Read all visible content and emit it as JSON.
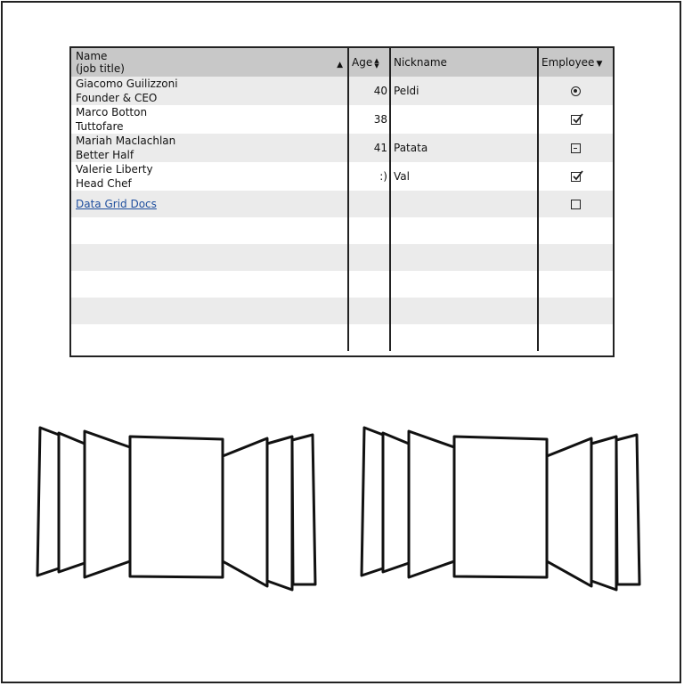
{
  "grid": {
    "headers": {
      "name_line1": "Name",
      "name_line2": "(job title)",
      "age": "Age",
      "nickname": "Nickname",
      "employee": "Employee"
    },
    "rows": [
      {
        "name": "Giacomo Guilizzoni",
        "title": "Founder & CEO",
        "age": "40",
        "nickname": "Peldi",
        "employee_control": "radio-selected"
      },
      {
        "name": "Marco Botton",
        "title": "Tuttofare",
        "age": "38",
        "nickname": "",
        "employee_control": "checkbox-checked"
      },
      {
        "name": "Mariah Maclachlan",
        "title": "Better Half",
        "age": "41",
        "nickname": "Patata",
        "employee_control": "checkbox-indeterminate"
      },
      {
        "name": "Valerie Liberty",
        "title": "Head Chef",
        "age": ":)",
        "nickname": "Val",
        "employee_control": "checkbox-checked"
      }
    ],
    "link_row": {
      "link_text": "Data Grid Docs",
      "employee_control": "checkbox-unchecked"
    }
  }
}
